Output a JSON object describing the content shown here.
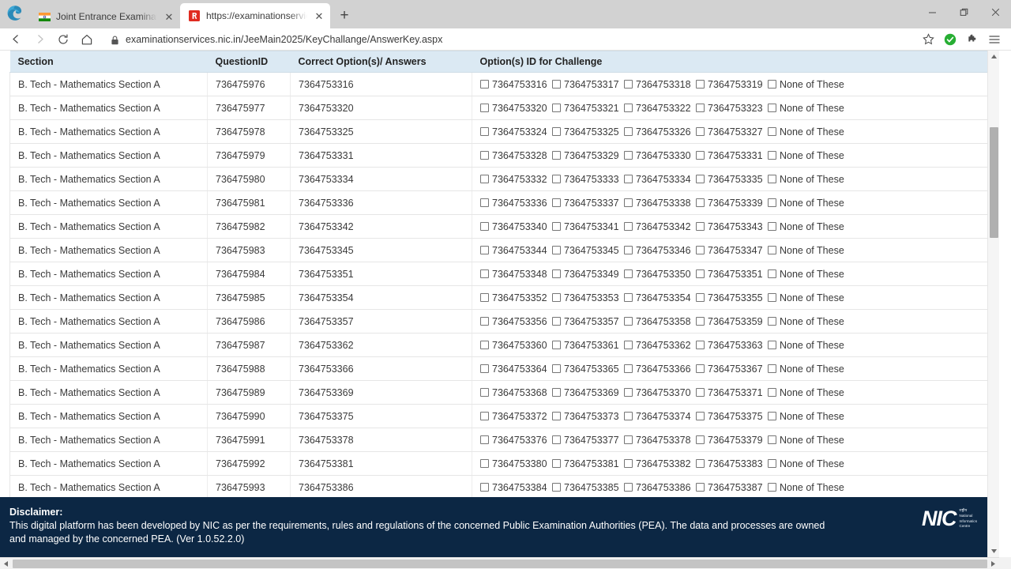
{
  "window": {
    "controls": {
      "minimize": "—",
      "restore": "❐",
      "close": "✕"
    }
  },
  "tabs": [
    {
      "title": "Joint Entrance Examination (J",
      "favicon": "india-flag-icon",
      "active": false,
      "close_label": "✕"
    },
    {
      "title": "https://examinationservices.n",
      "favicon": "red-document-icon",
      "active": true,
      "close_label": "✕"
    }
  ],
  "newtab_label": "+",
  "navbar": {
    "back_icon": "back-arrow-icon",
    "forward_icon": "forward-arrow-icon",
    "reload_icon": "reload-icon",
    "home_icon": "home-icon",
    "lock_icon": "lock-icon",
    "url": "examinationservices.nic.in/JeeMain2025/KeyChallange/AnswerKey.aspx",
    "favorite_icon": "star-icon",
    "status_icon": "green-check-icon",
    "extensions_icon": "puzzle-piece-icon",
    "menu_icon": "hamburger-menu-icon"
  },
  "table": {
    "headers": [
      "Section",
      "QuestionID",
      "Correct Option(s)/ Answers",
      "Option(s) ID for Challenge"
    ],
    "none_of_these_label": "None of These",
    "rows": [
      {
        "section": "B. Tech - Mathematics Section A",
        "question_id": "736475976",
        "correct": "7364753316",
        "options": [
          "7364753316",
          "7364753317",
          "7364753318",
          "7364753319"
        ]
      },
      {
        "section": "B. Tech - Mathematics Section A",
        "question_id": "736475977",
        "correct": "7364753320",
        "options": [
          "7364753320",
          "7364753321",
          "7364753322",
          "7364753323"
        ]
      },
      {
        "section": "B. Tech - Mathematics Section A",
        "question_id": "736475978",
        "correct": "7364753325",
        "options": [
          "7364753324",
          "7364753325",
          "7364753326",
          "7364753327"
        ]
      },
      {
        "section": "B. Tech - Mathematics Section A",
        "question_id": "736475979",
        "correct": "7364753331",
        "options": [
          "7364753328",
          "7364753329",
          "7364753330",
          "7364753331"
        ]
      },
      {
        "section": "B. Tech - Mathematics Section A",
        "question_id": "736475980",
        "correct": "7364753334",
        "options": [
          "7364753332",
          "7364753333",
          "7364753334",
          "7364753335"
        ]
      },
      {
        "section": "B. Tech - Mathematics Section A",
        "question_id": "736475981",
        "correct": "7364753336",
        "options": [
          "7364753336",
          "7364753337",
          "7364753338",
          "7364753339"
        ]
      },
      {
        "section": "B. Tech - Mathematics Section A",
        "question_id": "736475982",
        "correct": "7364753342",
        "options": [
          "7364753340",
          "7364753341",
          "7364753342",
          "7364753343"
        ]
      },
      {
        "section": "B. Tech - Mathematics Section A",
        "question_id": "736475983",
        "correct": "7364753345",
        "options": [
          "7364753344",
          "7364753345",
          "7364753346",
          "7364753347"
        ]
      },
      {
        "section": "B. Tech - Mathematics Section A",
        "question_id": "736475984",
        "correct": "7364753351",
        "options": [
          "7364753348",
          "7364753349",
          "7364753350",
          "7364753351"
        ]
      },
      {
        "section": "B. Tech - Mathematics Section A",
        "question_id": "736475985",
        "correct": "7364753354",
        "options": [
          "7364753352",
          "7364753353",
          "7364753354",
          "7364753355"
        ]
      },
      {
        "section": "B. Tech - Mathematics Section A",
        "question_id": "736475986",
        "correct": "7364753357",
        "options": [
          "7364753356",
          "7364753357",
          "7364753358",
          "7364753359"
        ]
      },
      {
        "section": "B. Tech - Mathematics Section A",
        "question_id": "736475987",
        "correct": "7364753362",
        "options": [
          "7364753360",
          "7364753361",
          "7364753362",
          "7364753363"
        ]
      },
      {
        "section": "B. Tech - Mathematics Section A",
        "question_id": "736475988",
        "correct": "7364753366",
        "options": [
          "7364753364",
          "7364753365",
          "7364753366",
          "7364753367"
        ]
      },
      {
        "section": "B. Tech - Mathematics Section A",
        "question_id": "736475989",
        "correct": "7364753369",
        "options": [
          "7364753368",
          "7364753369",
          "7364753370",
          "7364753371"
        ]
      },
      {
        "section": "B. Tech - Mathematics Section A",
        "question_id": "736475990",
        "correct": "7364753375",
        "options": [
          "7364753372",
          "7364753373",
          "7364753374",
          "7364753375"
        ]
      },
      {
        "section": "B. Tech - Mathematics Section A",
        "question_id": "736475991",
        "correct": "7364753378",
        "options": [
          "7364753376",
          "7364753377",
          "7364753378",
          "7364753379"
        ]
      },
      {
        "section": "B. Tech - Mathematics Section A",
        "question_id": "736475992",
        "correct": "7364753381",
        "options": [
          "7364753380",
          "7364753381",
          "7364753382",
          "7364753383"
        ]
      },
      {
        "section": "B. Tech - Mathematics Section A",
        "question_id": "736475993",
        "correct": "7364753386",
        "options": [
          "7364753384",
          "7364753385",
          "7364753386",
          "7364753387"
        ]
      }
    ]
  },
  "footer": {
    "disclaimer_title": "Disclaimer:",
    "disclaimer_body": "This digital platform has been developed by NIC as per the requirements, rules and regulations of the concerned Public Examination Authorities (PEA). The data and processes are owned and managed by the concerned PEA. (Ver 1.0.52.2.0)",
    "logo_word": "NIC",
    "logo_sub_line1": "राष्ट्रीय",
    "logo_sub_line2": "National",
    "logo_sub_line3": "Informatics",
    "logo_sub_line4": "Centre"
  },
  "colors": {
    "header_bg": "#dbe9f3",
    "footer_bg": "#0c2744",
    "chrome_bg": "#d2d2d2",
    "status_green": "#27ae33"
  }
}
